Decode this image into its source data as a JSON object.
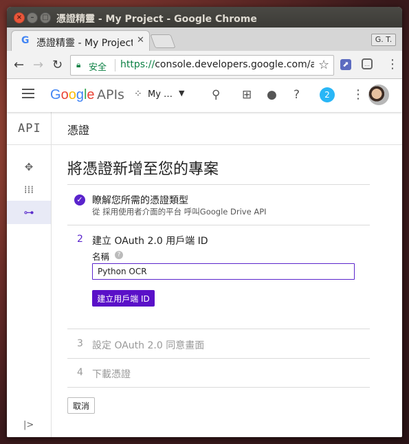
{
  "window": {
    "title": "憑證精靈 - My Project - Google Chrome"
  },
  "tab": {
    "title": "憑證精靈 - My Project",
    "close": "✕"
  },
  "profile_badge": "G. T.",
  "omnibox": {
    "secure_label": "安全",
    "url_scheme": "https://",
    "url_rest": "console.developers.google.com/ap…"
  },
  "appbar": {
    "logo": [
      "G",
      "o",
      "o",
      "g",
      "l",
      "e"
    ],
    "apis": "APIs",
    "project": "My …",
    "notification_count": "2"
  },
  "sidebar": {
    "logo": "API",
    "items": [
      {
        "name": "dashboard",
        "icon": "✥"
      },
      {
        "name": "library",
        "icon": "⁞⁞⁞"
      },
      {
        "name": "credentials",
        "icon": "⊶"
      }
    ]
  },
  "header": {
    "section_title": "憑證"
  },
  "wizard": {
    "heading": "將憑證新增至您的專案",
    "step1": {
      "title": "瞭解您所需的憑證類型",
      "subtitle": "從 採用使用者介面的平台 呼叫Google Drive API"
    },
    "step2": {
      "number": "2",
      "title": "建立 OAuth 2.0 用戶端 ID",
      "name_label": "名稱",
      "name_value": "Python OCR",
      "create_button": "建立用戶端 ID"
    },
    "step3": {
      "number": "3",
      "title": "設定 OAuth 2.0 同意畫面"
    },
    "step4": {
      "number": "4",
      "title": "下載憑證"
    },
    "cancel_button": "取消"
  },
  "colors": {
    "accent": "#5a24cc",
    "secure_green": "#0b8043"
  }
}
